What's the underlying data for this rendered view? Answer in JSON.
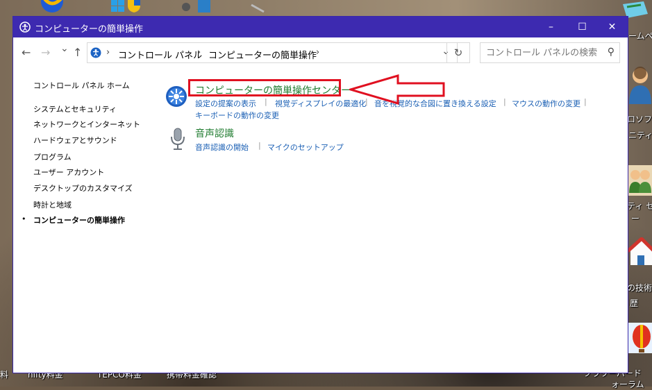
{
  "window": {
    "title": "コンピューターの簡単操作",
    "minimize": "–",
    "maximize": "☐",
    "close": "✕"
  },
  "nav": {
    "back": "←",
    "forward": "→",
    "recent": "⌄",
    "up": "↑",
    "breadcrumb": [
      "コントロール パネル",
      "コンピューターの簡単操作"
    ],
    "separator": "›",
    "dropdown": "⌄",
    "refresh": "↻",
    "search_placeholder": "コントロール パネルの検索",
    "search_icon": "⚲"
  },
  "sidebar": {
    "home": "コントロール パネル ホーム",
    "items": [
      "システムとセキュリティ",
      "ネットワークとインターネット",
      "ハードウェアとサウンド",
      "プログラム",
      "ユーザー アカウント",
      "デスクトップのカスタマイズ",
      "時計と地域",
      "コンピューターの簡単操作"
    ],
    "bullet": "•"
  },
  "categories": {
    "ease": {
      "title": "コンピューターの簡単操作センター",
      "icon": "ease-of-access-icon",
      "tasks": [
        "設定の提案の表示",
        "視覚ディスプレイの最適化",
        "音を視覚的な合図に置き換える設定",
        "マウスの動作の変更",
        "キーボードの動作の変更"
      ]
    },
    "speech": {
      "title": "音声認識",
      "icon": "microphone-icon",
      "tasks": [
        "音声認識の開始",
        "マイクのセットアップ"
      ]
    }
  },
  "desktop": {
    "labels": [
      "ームペ",
      "ロソフト",
      "ニティ",
      "ティ セ",
      "ー",
      "の技術",
      "歴",
      "料",
      "nifty料金",
      "TEPCO料金",
      "携帯料金確認",
      "フラワーパード",
      "ォーラム"
    ]
  },
  "colors": {
    "titlebar": "#3d2ab0",
    "link": "#1a5fb4",
    "category": "#1e7b2e",
    "highlight": "#e01020"
  }
}
